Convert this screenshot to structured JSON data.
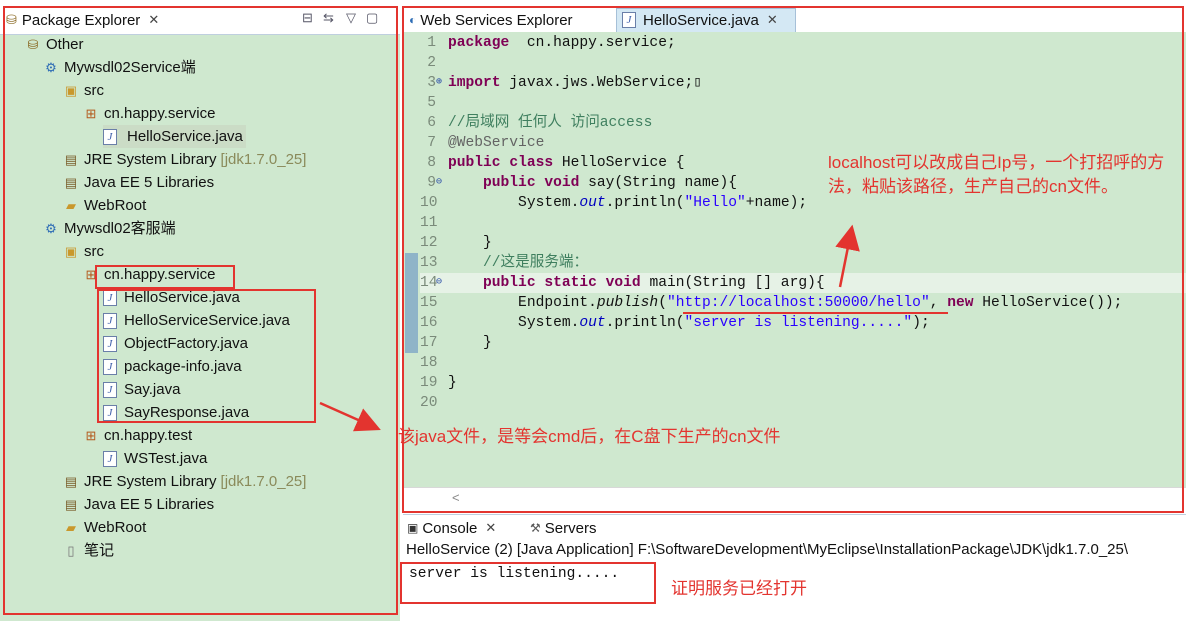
{
  "left": {
    "tab_title": "Package Explorer",
    "tab_close": "✕",
    "view_buttons": [
      "⊟",
      "⇆",
      "▽",
      "▢"
    ],
    "tree": [
      {
        "label": "Other",
        "icon": "other-working-set-icon",
        "glyph": "⛁",
        "cls": "ico-other"
      },
      {
        "label": "Mywsdl02Service端",
        "icon": "project-icon",
        "glyph": "⚙",
        "cls": "ico-proj"
      },
      {
        "label": "src",
        "icon": "source-folder-icon",
        "glyph": "▣",
        "cls": "ico-folder"
      },
      {
        "label": "cn.happy.service",
        "icon": "package-icon",
        "glyph": "⊞",
        "cls": "ico-pkg"
      },
      {
        "label": "HelloService.java",
        "icon": "java-file-icon",
        "glyph": "J",
        "cls": "ico-java",
        "selected": true
      },
      {
        "label": "JRE System Library",
        "suffix": "[jdk1.7.0_25]",
        "icon": "library-icon",
        "glyph": "▤",
        "cls": "ico-lib"
      },
      {
        "label": "Java EE 5 Libraries",
        "icon": "library-icon",
        "glyph": "▤",
        "cls": "ico-lib"
      },
      {
        "label": "WebRoot",
        "icon": "folder-icon",
        "glyph": "▰",
        "cls": "ico-folder"
      },
      {
        "label": "Mywsdl02客服端",
        "icon": "project-icon",
        "glyph": "⚙",
        "cls": "ico-proj"
      },
      {
        "label": "src",
        "icon": "source-folder-icon",
        "glyph": "▣",
        "cls": "ico-folder"
      },
      {
        "label": "cn.happy.service",
        "icon": "package-icon",
        "glyph": "⊞",
        "cls": "ico-pkg"
      },
      {
        "label": "HelloService.java",
        "icon": "java-file-icon",
        "glyph": "J",
        "cls": "ico-java"
      },
      {
        "label": "HelloServiceService.java",
        "icon": "java-file-icon",
        "glyph": "J",
        "cls": "ico-java"
      },
      {
        "label": "ObjectFactory.java",
        "icon": "java-file-icon",
        "glyph": "J",
        "cls": "ico-java"
      },
      {
        "label": "package-info.java",
        "icon": "java-file-icon",
        "glyph": "J",
        "cls": "ico-java"
      },
      {
        "label": "Say.java",
        "icon": "java-file-icon",
        "glyph": "J",
        "cls": "ico-java"
      },
      {
        "label": "SayResponse.java",
        "icon": "java-file-icon",
        "glyph": "J",
        "cls": "ico-java"
      },
      {
        "label": "cn.happy.test",
        "icon": "package-icon",
        "glyph": "⊞",
        "cls": "ico-pkg"
      },
      {
        "label": "WSTest.java",
        "icon": "java-file-icon",
        "glyph": "J",
        "cls": "ico-java"
      },
      {
        "label": "JRE System Library",
        "suffix": "[jdk1.7.0_25]",
        "icon": "library-icon",
        "glyph": "▤",
        "cls": "ico-lib"
      },
      {
        "label": "Java EE 5 Libraries",
        "icon": "library-icon",
        "glyph": "▤",
        "cls": "ico-lib"
      },
      {
        "label": "WebRoot",
        "icon": "folder-icon",
        "glyph": "▰",
        "cls": "ico-folder"
      },
      {
        "label": "笔记",
        "icon": "text-file-icon",
        "glyph": "▯",
        "cls": "ico-doc"
      }
    ]
  },
  "editor": {
    "tabs": [
      {
        "label": "Web Services Explorer",
        "icon": "web-services-icon"
      },
      {
        "label": "HelloService.java",
        "icon": "java-file-icon",
        "close": "✕"
      }
    ],
    "lines": [
      {
        "n": "1",
        "tokens": [
          [
            "kw",
            "package"
          ],
          [
            "",
            "  cn.happy.service;"
          ]
        ]
      },
      {
        "n": "2",
        "tokens": []
      },
      {
        "n": "3",
        "tokens": [
          [
            "kw",
            "import"
          ],
          [
            "",
            " javax.jws.WebService;"
          ],
          [
            "",
            "▯"
          ]
        ],
        "fold": "⊕"
      },
      {
        "n": "5",
        "tokens": []
      },
      {
        "n": "6",
        "tokens": [
          [
            "cmt",
            "//局域网 任何人 访问access"
          ]
        ]
      },
      {
        "n": "7",
        "tokens": [
          [
            "ann",
            "@WebService"
          ]
        ]
      },
      {
        "n": "8",
        "tokens": [
          [
            "kw",
            "public"
          ],
          [
            "",
            " "
          ],
          [
            "kw",
            "class"
          ],
          [
            "",
            " HelloService {"
          ]
        ]
      },
      {
        "n": "9",
        "tokens": [
          [
            "",
            "    "
          ],
          [
            "kw",
            "public"
          ],
          [
            "",
            " "
          ],
          [
            "kw",
            "void"
          ],
          [
            "",
            " say(String name){"
          ]
        ],
        "fold": "⊖"
      },
      {
        "n": "10",
        "tokens": [
          [
            "",
            "        System."
          ],
          [
            "itl",
            "out"
          ],
          [
            "",
            ".println("
          ],
          [
            "str",
            "\"Hello\""
          ],
          [
            "",
            "+name);"
          ]
        ]
      },
      {
        "n": "11",
        "tokens": []
      },
      {
        "n": "12",
        "tokens": [
          [
            "",
            "    }"
          ]
        ]
      },
      {
        "n": "13",
        "tokens": [
          [
            "",
            "    "
          ],
          [
            "cmt",
            "//这是服务端："
          ]
        ]
      },
      {
        "n": "14",
        "tokens": [
          [
            "",
            "    "
          ],
          [
            "kw",
            "public"
          ],
          [
            "",
            " "
          ],
          [
            "kw",
            "static"
          ],
          [
            "",
            " "
          ],
          [
            "kw",
            "void"
          ],
          [
            "",
            " main(String [] arg){"
          ]
        ],
        "fold": "⊖"
      },
      {
        "n": "15",
        "tokens": [
          [
            "",
            "        Endpoint."
          ],
          [
            "itl-m",
            "publish"
          ],
          [
            "",
            "("
          ],
          [
            "str",
            "\"http://localhost:50000/hello\""
          ],
          [
            "",
            ", "
          ],
          [
            "kw",
            "new"
          ],
          [
            "",
            " HelloService());"
          ]
        ]
      },
      {
        "n": "16",
        "tokens": [
          [
            "",
            "        System."
          ],
          [
            "itl",
            "out"
          ],
          [
            "",
            ".println("
          ],
          [
            "str",
            "\"server is listening.....\""
          ],
          [
            "",
            ");"
          ]
        ]
      },
      {
        "n": "17",
        "tokens": [
          [
            "",
            "    }"
          ]
        ]
      },
      {
        "n": "18",
        "tokens": []
      },
      {
        "n": "19",
        "tokens": [
          [
            "",
            "}"
          ]
        ]
      },
      {
        "n": "20",
        "tokens": []
      }
    ],
    "scroll_left": "<"
  },
  "console": {
    "tabs": [
      {
        "label": "Console",
        "icon": "console-icon",
        "close": "✕"
      },
      {
        "label": "Servers",
        "icon": "servers-icon"
      }
    ],
    "header": "HelloService (2) [Java Application] F:\\SoftwareDevelopment\\MyEclipse\\InstallationPackage\\JDK\\jdk1.7.0_25\\",
    "output": "server is listening....."
  },
  "annotations": {
    "note_localhost": "localhost可以改成自己Ip号，一个打招呼的方法，粘贴该路径，生产自己的cn文件。",
    "note_java_files": "该java文件，是等会cmd后，在C盘下生产的cn文件",
    "note_server_open": "证明服务已经打开",
    "color": "#e3342f"
  }
}
